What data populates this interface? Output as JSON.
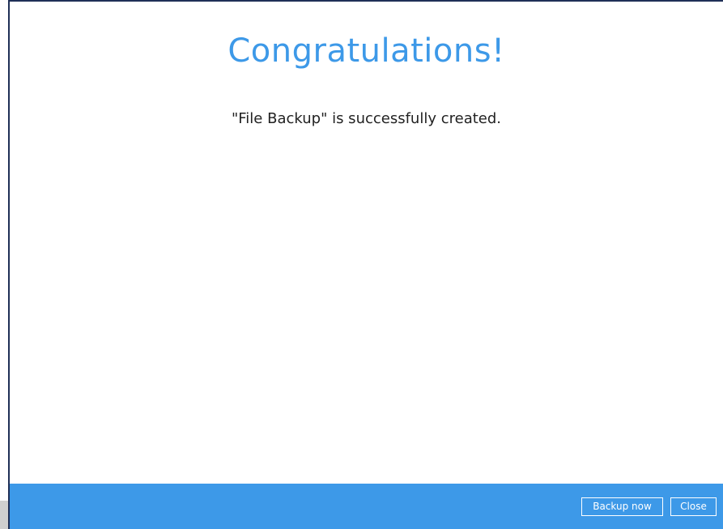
{
  "dialog": {
    "title": "Congratulations!",
    "message": "\"File Backup\" is successfully created."
  },
  "footer": {
    "backup_now_label": "Backup now",
    "close_label": "Close"
  },
  "colors": {
    "accent": "#3d99e8",
    "text": "#222222",
    "border": "#1f2f57"
  }
}
